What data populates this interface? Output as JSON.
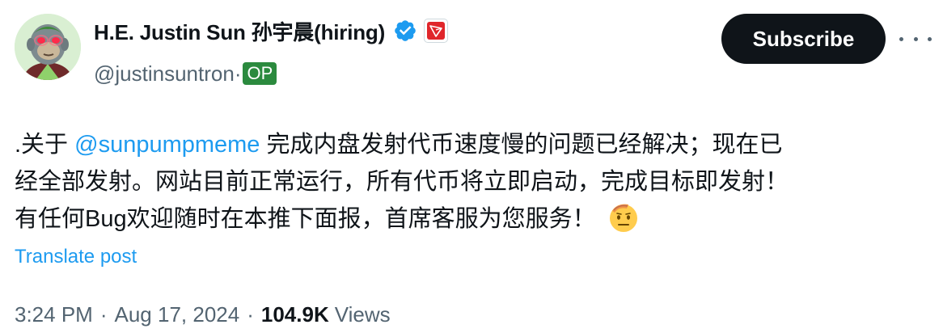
{
  "author": {
    "display_name": "H.E. Justin Sun 孙宇晨(hiring)",
    "handle": "@justinsuntron",
    "handle_separator": "·",
    "op_label": "OP"
  },
  "actions": {
    "subscribe_label": "Subscribe"
  },
  "post": {
    "text_prefix": ".关于 ",
    "mention": "@sunpumpmeme",
    "text_line1_rest": " 完成内盘发射代币速度慢的问题已经解决；现在已",
    "text_line2": "经全部发射。网站目前正常运行，所有代币将立即启动，完成目标即发射！",
    "text_line3": "有任何Bug欢迎随时在本推下面报，首席客服为您服务！",
    "emoji_name": "saluting-face-emoji",
    "translate_label": "Translate post"
  },
  "meta": {
    "time": "3:24 PM",
    "separator": "·",
    "date": "Aug 17, 2024",
    "views_count": "104.9K",
    "views_label": "Views"
  },
  "colors": {
    "link_blue": "#1d9bf0",
    "text_primary": "#0f1419",
    "text_secondary": "#536471",
    "button_bg": "#0f1419",
    "op_badge_green": "#2b8a3e",
    "tron_red": "#e0262b"
  }
}
